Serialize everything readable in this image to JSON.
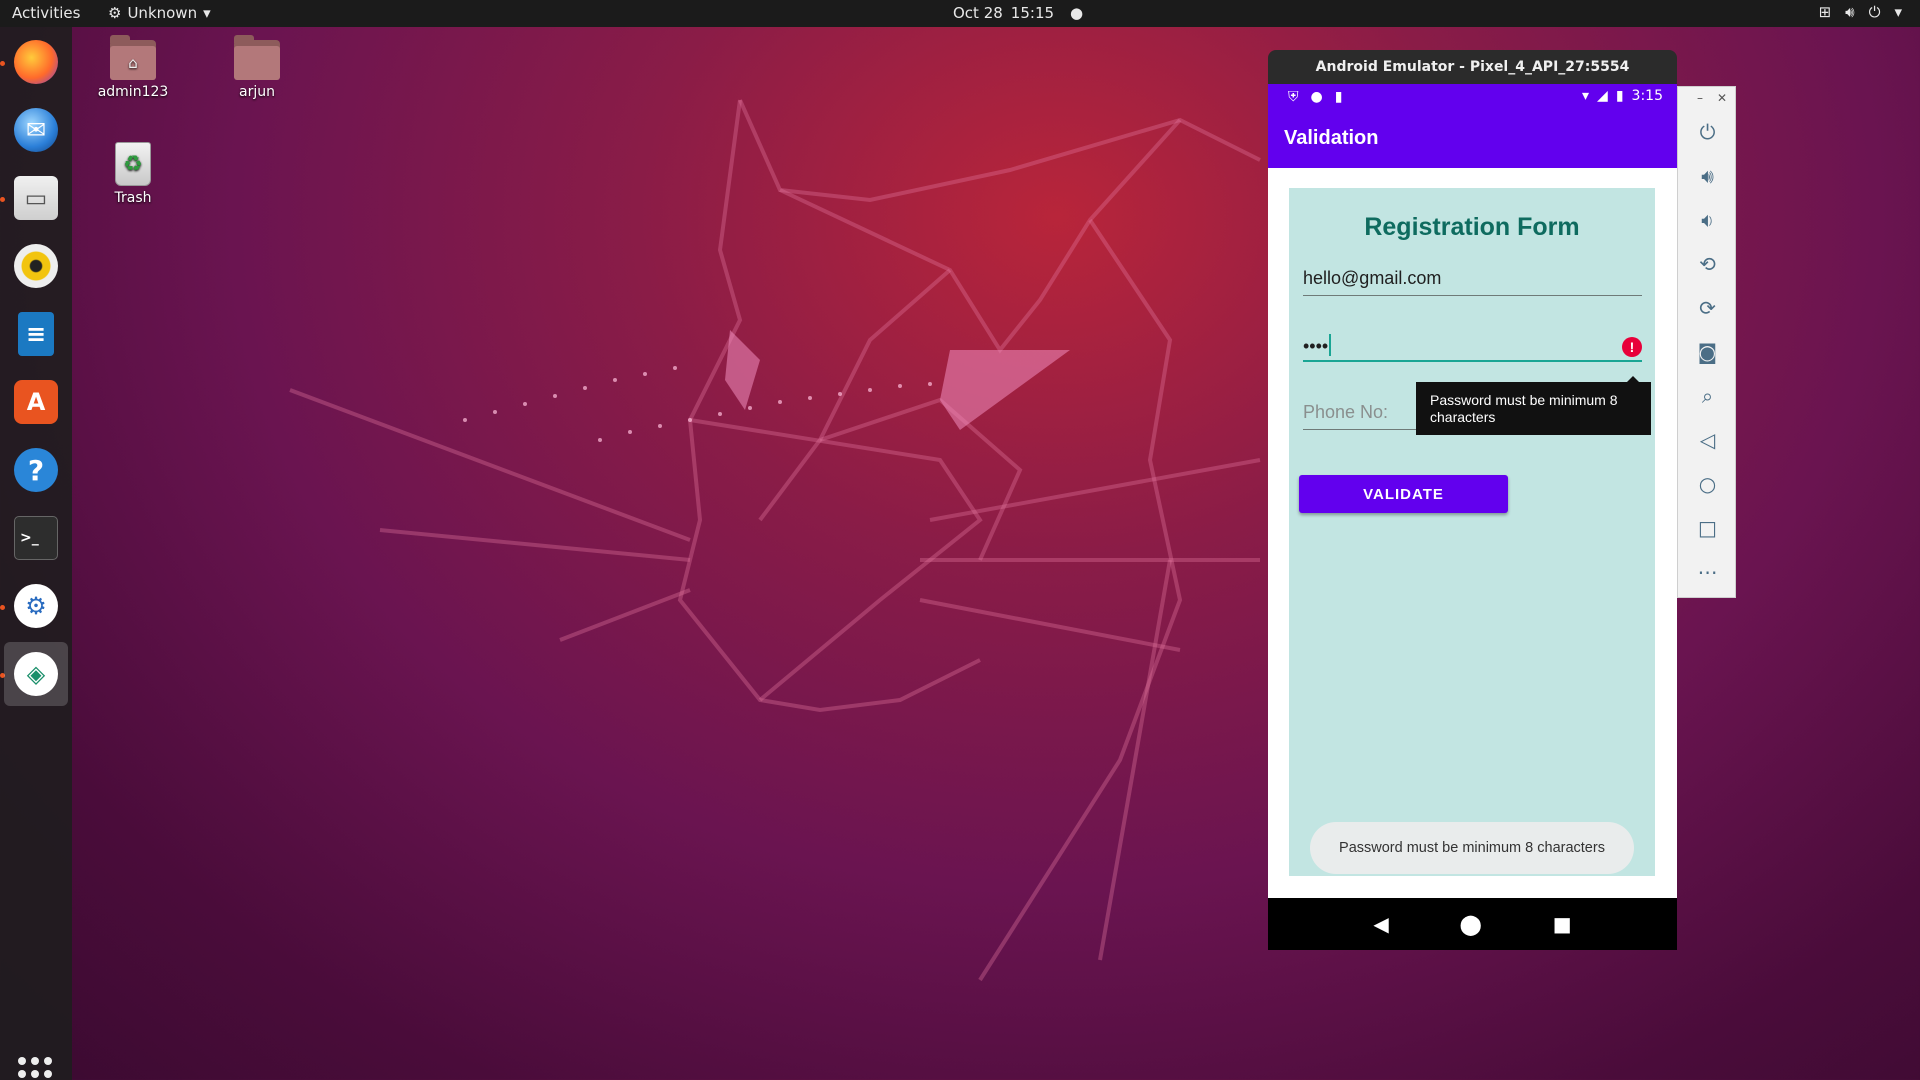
{
  "topbar": {
    "activities": "Activities",
    "app_menu": "Unknown",
    "date": "Oct 28",
    "time": "15:15",
    "tray_icons": [
      "network-icon",
      "volume-icon",
      "power-icon"
    ]
  },
  "dock": {
    "items": [
      "firefox",
      "thunderbird",
      "files",
      "rhythmbox",
      "libreoffice-writer",
      "software-center",
      "help",
      "terminal",
      "android-studio",
      "emulator"
    ],
    "show_apps": "show-applications"
  },
  "desktop": {
    "icons": [
      {
        "label": "admin123"
      },
      {
        "label": "arjun"
      },
      {
        "label": "Trash"
      }
    ]
  },
  "emulator": {
    "window_title": "Android Emulator - Pixel_4_API_27:5554",
    "status_time": "3:15",
    "app_title": "Validation",
    "form": {
      "title": "Registration Form",
      "email_value": "hello@gmail.com",
      "password_value": "••••",
      "phone_placeholder": "Phone No:",
      "error_icon": "!",
      "error_tooltip": "Password must be minimum 8 characters",
      "validate_label": "VALIDATE"
    },
    "toast": "Password must be minimum 8 characters",
    "nav": {
      "back": "◀",
      "home": "⬤",
      "recents": "■"
    }
  },
  "side_toolbar": {
    "tools": [
      "power",
      "volume-up",
      "volume-down",
      "rotate-left",
      "rotate-right",
      "screenshot",
      "zoom",
      "back",
      "home",
      "overview",
      "more"
    ]
  },
  "colors": {
    "accent": "#6200ee",
    "form_bg": "#c2e5e2",
    "form_title": "#0e6b5f",
    "error": "#e8003a",
    "ubuntu_orange": "#e95420"
  }
}
